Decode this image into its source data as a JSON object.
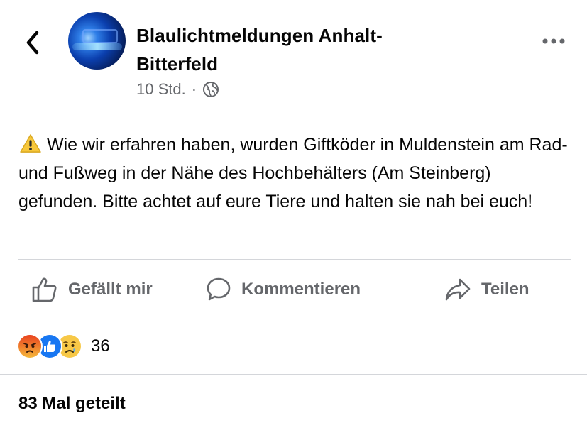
{
  "post_header": {
    "page_name": "Blaulichtmeldungen Anhalt-Bitterfeld",
    "page_name_line1": "Blaulichtmeldungen Anhalt-",
    "page_name_line2": "Bitterfeld",
    "time": "10 Std.",
    "separator": "·",
    "audience_icon": "globe-icon",
    "back_icon": "chevron-left-icon",
    "more_icon": "more-options-icon"
  },
  "post": {
    "warning_icon": "warning-icon",
    "text": "Wie wir erfahren haben, wurden Giftköder in Muldenstein am Rad- und Fußweg in der Nähe des Hochbehälters (Am Steinberg) gefunden. Bitte achtet auf eure Tiere und halten sie nah bei euch!"
  },
  "actions": [
    {
      "label": "Gefällt mir",
      "icon": "thumbs-up-icon"
    },
    {
      "label": "Kommentieren",
      "icon": "comment-icon"
    },
    {
      "label": "Teilen",
      "icon": "share-icon"
    }
  ],
  "reactions": {
    "icons": [
      "angry-reaction-icon",
      "like-reaction-icon",
      "sad-reaction-icon"
    ],
    "count": "36"
  },
  "shares": {
    "label": "83 Mal geteilt"
  },
  "colors": {
    "text": "#050505",
    "secondary": "#65676b",
    "like_blue": "#1877f2",
    "divider": "#d4d6da"
  }
}
